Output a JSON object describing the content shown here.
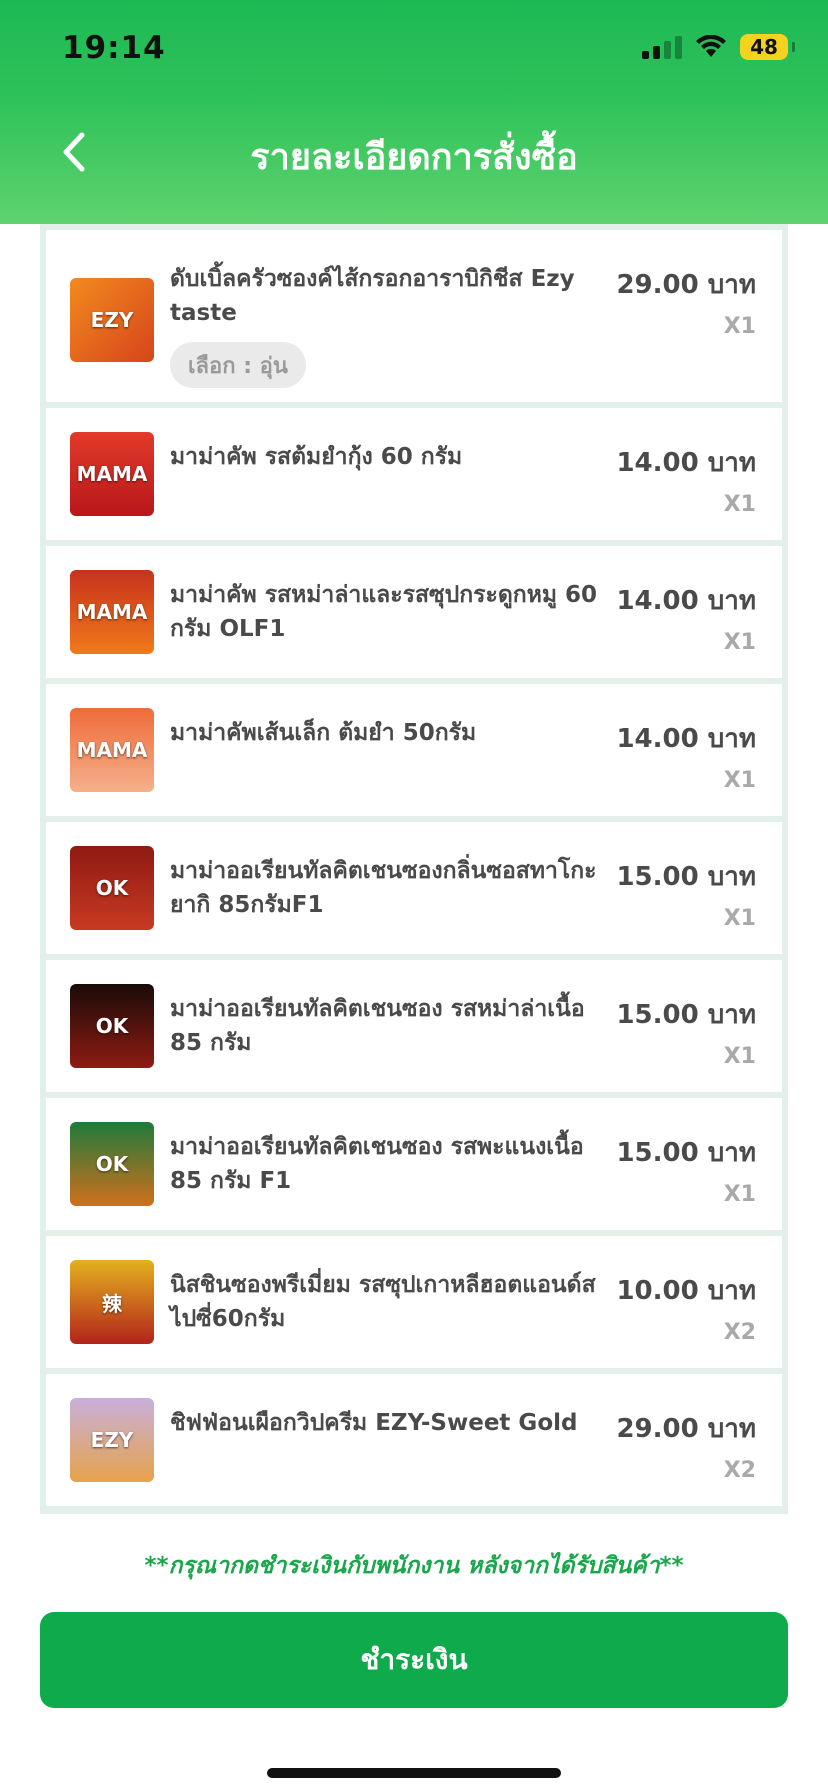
{
  "status_bar": {
    "time": "19:14",
    "battery": "48"
  },
  "header": {
    "title": "รายละเอียดการสั่งซื้อ"
  },
  "items": [
    {
      "name": "ดับเบิ้ลครัวซองค์ไส้กรอกอาราบิกิชีส Ezy taste",
      "price": "29.00 บาท",
      "qty": "X1",
      "option": "เลือก : อุ่น"
    },
    {
      "name": "มาม่าคัพ รสต้มยำกุ้ง 60 กรัม",
      "price": "14.00 บาท",
      "qty": "X1"
    },
    {
      "name": "มาม่าคัพ รสหม่าล่าและรสซุปกระดูกหมู 60 กรัม OLF1",
      "price": "14.00 บาท",
      "qty": "X1"
    },
    {
      "name": "มาม่าคัพเส้นเล็ก ต้มยำ 50กรัม",
      "price": "14.00 บาท",
      "qty": "X1"
    },
    {
      "name": "มาม่าออเรียนทัลคิตเชนซองกลิ่นซอสทาโกะยากิ 85กรัมF1",
      "price": "15.00 บาท",
      "qty": "X1"
    },
    {
      "name": "มาม่าออเรียนทัลคิตเชนซอง รสหม่าล่าเนื้อ 85 กรัม",
      "price": "15.00 บาท",
      "qty": "X1"
    },
    {
      "name": "มาม่าออเรียนทัลคิตเชนซอง รสพะแนงเนื้อ 85 กรัม F1",
      "price": "15.00 บาท",
      "qty": "X1"
    },
    {
      "name": "นิสชินซองพรีเมี่ยม รสซุปเกาหลีฮอตแอนด์สไปซี่60กรัม",
      "price": "10.00 บาท",
      "qty": "X2"
    },
    {
      "name": "ชิฟฟ่อนเผือกวิปครีม EZY-Sweet Gold",
      "price": "29.00 บาท",
      "qty": "X2"
    }
  ],
  "footer": {
    "notice": "**กรุณากดชำระเงินกับพนักงาน หลังจากได้รับสินค้า**",
    "pay_button": "ชำระเงิน"
  },
  "colors": {
    "header_green": "#2fc25a",
    "button_green": "#0eaa4c",
    "notice_green": "#1aa64a"
  }
}
